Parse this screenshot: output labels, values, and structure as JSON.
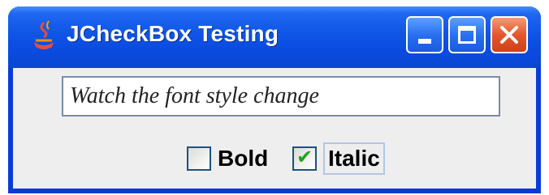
{
  "window": {
    "title": "JCheckBox Testing",
    "icons": {
      "app": "java-cup-icon",
      "minimize": "minimize-icon",
      "maximize": "maximize-icon",
      "close": "close-icon"
    }
  },
  "textfield": {
    "value": "Watch the font style change"
  },
  "checkboxes": [
    {
      "label": "Bold",
      "checked": false
    },
    {
      "label": "Italic",
      "checked": true
    }
  ],
  "colors": {
    "titlebar": "#0a4be0",
    "close": "#e5562a",
    "content_bg": "#eeeeee"
  }
}
